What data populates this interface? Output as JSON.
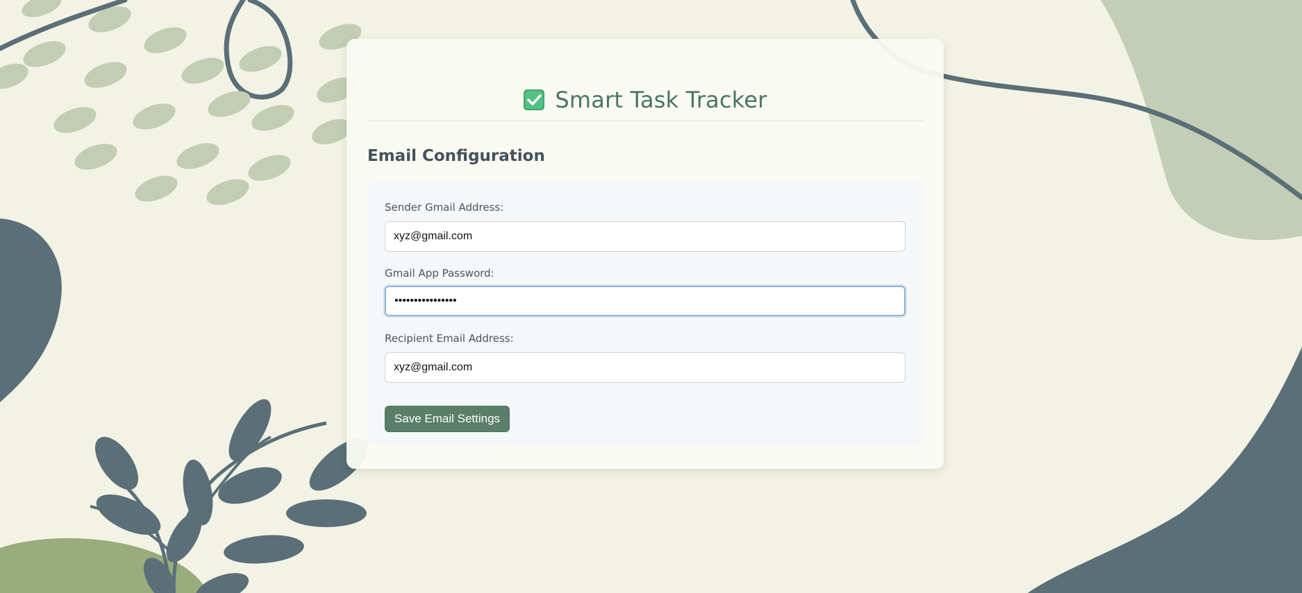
{
  "header": {
    "title": "Smart Task Tracker",
    "icon": "check-mark-button-icon"
  },
  "email_config": {
    "heading": "Email Configuration",
    "sender": {
      "label": "Sender Gmail Address:",
      "value": "xyz@gmail.com"
    },
    "password": {
      "label": "Gmail App Password:",
      "value": "••••••••••••••••"
    },
    "recipient": {
      "label": "Recipient Email Address:",
      "value": "xyz@gmail.com"
    },
    "save_label": "Save Email Settings"
  },
  "colors": {
    "accent": "#5a7e69",
    "title": "#4a7566",
    "background": "#f3f3e5",
    "decor_dark": "#5a6f78",
    "decor_light": "#c3cdb4"
  }
}
